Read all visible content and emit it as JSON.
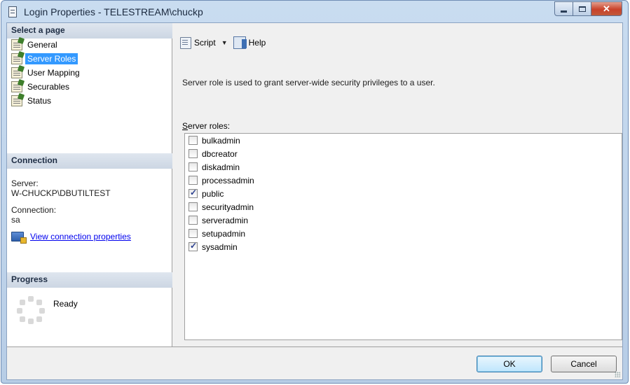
{
  "window": {
    "title": "Login Properties - TELESTREAM\\chuckp"
  },
  "left_panel": {
    "select_page_header": "Select a page",
    "pages": [
      {
        "label": "General",
        "selected": false
      },
      {
        "label": "Server Roles",
        "selected": true
      },
      {
        "label": "User Mapping",
        "selected": false
      },
      {
        "label": "Securables",
        "selected": false
      },
      {
        "label": "Status",
        "selected": false
      }
    ],
    "connection_header": "Connection",
    "server_label": "Server:",
    "server_value": "W-CHUCKP\\DBUTILTEST",
    "connection_label": "Connection:",
    "connection_value": "sa",
    "view_link": "View connection properties",
    "progress_header": "Progress",
    "progress_status": "Ready"
  },
  "toolbar": {
    "script_label": "Script",
    "help_label": "Help"
  },
  "main": {
    "description": "Server role is used to grant server-wide security privileges to a user.",
    "roles_caption_first": "S",
    "roles_caption_rest": "erver roles:",
    "roles": [
      {
        "name": "bulkadmin",
        "checked": false
      },
      {
        "name": "dbcreator",
        "checked": false
      },
      {
        "name": "diskadmin",
        "checked": false
      },
      {
        "name": "processadmin",
        "checked": false
      },
      {
        "name": "public",
        "checked": true
      },
      {
        "name": "securityadmin",
        "checked": false
      },
      {
        "name": "serveradmin",
        "checked": false
      },
      {
        "name": "setupadmin",
        "checked": false
      },
      {
        "name": "sysadmin",
        "checked": true
      }
    ]
  },
  "buttons": {
    "ok": "OK",
    "cancel": "Cancel"
  },
  "colors": {
    "selection": "#3399ff",
    "link": "#0000ee",
    "header_bg": "#d6dfea"
  },
  "icons": {
    "page_item": "properties-page-icon",
    "script": "script-icon",
    "help": "help-icon",
    "connection_link": "connection-properties-icon",
    "progress": "spinner-icon"
  }
}
